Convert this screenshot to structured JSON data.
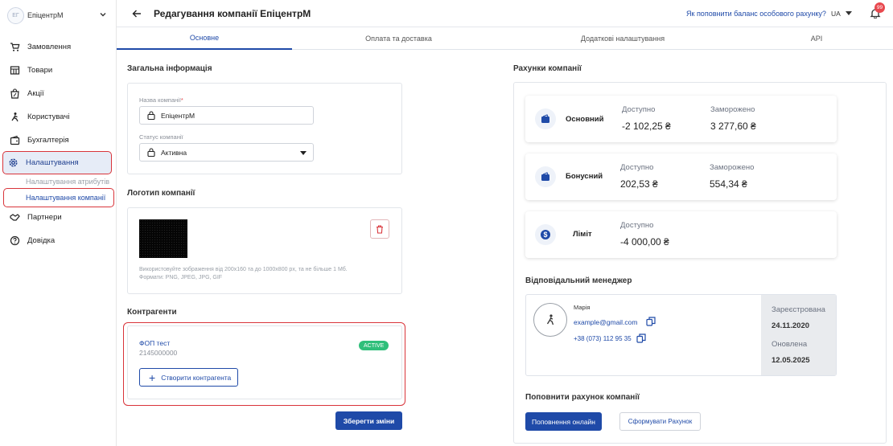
{
  "sidebar": {
    "avatar_initials": "ЕГ",
    "company": "ЕпіцентрМ",
    "items": [
      {
        "label": "Замовлення"
      },
      {
        "label": "Товари"
      },
      {
        "label": "Акції"
      },
      {
        "label": "Користувачі"
      },
      {
        "label": "Бухгалтерія"
      },
      {
        "label": "Налаштування"
      },
      {
        "label": "Партнери"
      },
      {
        "label": "Довідка"
      }
    ],
    "sub_items": [
      {
        "label": "Налаштування атрибутів"
      },
      {
        "label": "Налаштування компанії"
      }
    ]
  },
  "header": {
    "title": "Редагування компанії ЕпіцентрМ",
    "help_link": "Як поповнити баланс особового рахунку?",
    "lang": "UA",
    "notifications": "99"
  },
  "tabs": [
    {
      "label": "Основне"
    },
    {
      "label": "Оплата та доставка"
    },
    {
      "label": "Додаткові налаштування"
    },
    {
      "label": "API"
    }
  ],
  "general": {
    "title": "Загальна інформація",
    "name_label": "Назва компанії",
    "name_required": "*",
    "name_value": "ЕпіцентрМ",
    "status_label": "Статус компанії",
    "status_value": "Активна"
  },
  "logo": {
    "title": "Логотип компанії",
    "hint_line1": "Використовуйте зображення від 200х160 та до 1000х800 px, та не більше 1 Мб.",
    "hint_line2": "Формати: PNG, JPEG, JPG, GIF"
  },
  "contractors": {
    "title": "Контрагенти",
    "name": "ФОП тест",
    "id": "2145000000",
    "status": "ACTIVE",
    "create_label": "Створити контрагента"
  },
  "save_label": "Зберегти зміни",
  "accounts": {
    "title": "Рахунки компанії",
    "items": [
      {
        "name": "Основний",
        "available_label": "Доступно",
        "available": "-2 102,25 ₴",
        "frozen_label": "Заморожено",
        "frozen": "3 277,60 ₴"
      },
      {
        "name": "Бонусний",
        "available_label": "Доступно",
        "available": "202,53 ₴",
        "frozen_label": "Заморожено",
        "frozen": "554,34 ₴"
      },
      {
        "name": "Ліміт",
        "available_label": "Доступно",
        "available": "-4 000,00 ₴"
      }
    ]
  },
  "manager": {
    "title": "Відповідальний менеджер",
    "name": "Марія",
    "email": "example@gmail.com",
    "phone": "+38 (073) 112 95 35",
    "registered_label": "Зареєстрована",
    "registered": "24.11.2020",
    "updated_label": "Оновлена",
    "updated": "12.05.2025"
  },
  "topup": {
    "title": "Поповнити рахунок компанії",
    "online_label": "Поповнення онлайн",
    "invoice_label": "Сформувати Рахунок"
  },
  "colors": {
    "primary": "#1f4aa8",
    "danger": "#d9343a",
    "success": "#2fbf7a"
  }
}
